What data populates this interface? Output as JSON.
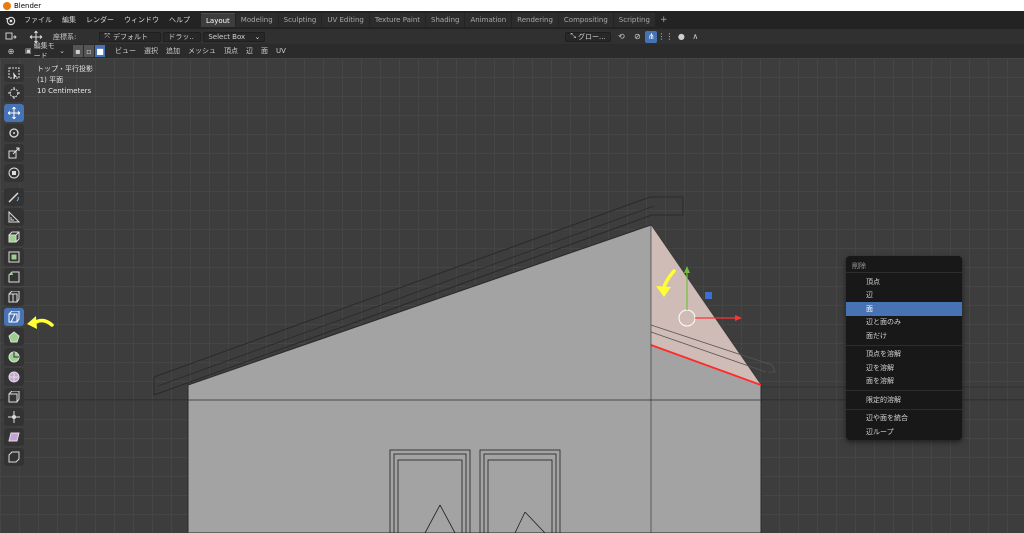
{
  "window": {
    "title": "Blender"
  },
  "menu": [
    "ファイル",
    "編集",
    "レンダー",
    "ウィンドウ",
    "ヘルプ"
  ],
  "workspaces": [
    "Layout",
    "Modeling",
    "Sculpting",
    "UV Editing",
    "Texture Paint",
    "Shading",
    "Animation",
    "Rendering",
    "Compositing",
    "Scripting"
  ],
  "workspace_plus": "+",
  "tool_header": {
    "orientation_label": "座標系:",
    "orientation_value": "デフォルト",
    "drag_label": "ドラッ..",
    "drag_value": "Select Box",
    "transform_orientation": "グロー..."
  },
  "editor_header": {
    "mode": "編集モード",
    "menus": [
      "ビュー",
      "選択",
      "追加",
      "メッシュ",
      "頂点",
      "辺",
      "面",
      "UV"
    ]
  },
  "viewport": {
    "view_name": "トップ・平行投影",
    "object_name": "(1) 平面",
    "scale": "10 Centimeters"
  },
  "context_menu": {
    "title": "削除",
    "groups": [
      [
        "頂点",
        "辺",
        "面",
        "辺と面のみ",
        "面だけ"
      ],
      [
        "頂点を溶解",
        "辺を溶解",
        "面を溶解"
      ],
      [
        "限定的溶解"
      ],
      [
        "辺や面を統合",
        "辺ループ"
      ]
    ],
    "selected": "面"
  },
  "colors": {
    "accent": "#4772b3",
    "highlight_yellow": "#ffff33",
    "selected_face": "#d9c2ba",
    "edge_red": "#ff2a2a"
  }
}
